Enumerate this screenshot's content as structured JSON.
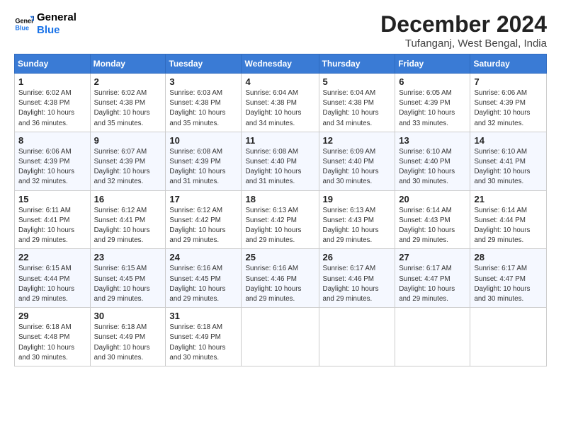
{
  "logo": {
    "line1": "General",
    "line2": "Blue"
  },
  "title": "December 2024",
  "location": "Tufanganj, West Bengal, India",
  "headers": [
    "Sunday",
    "Monday",
    "Tuesday",
    "Wednesday",
    "Thursday",
    "Friday",
    "Saturday"
  ],
  "weeks": [
    [
      {
        "day": "1",
        "info": "Sunrise: 6:02 AM\nSunset: 4:38 PM\nDaylight: 10 hours\nand 36 minutes."
      },
      {
        "day": "2",
        "info": "Sunrise: 6:02 AM\nSunset: 4:38 PM\nDaylight: 10 hours\nand 35 minutes."
      },
      {
        "day": "3",
        "info": "Sunrise: 6:03 AM\nSunset: 4:38 PM\nDaylight: 10 hours\nand 35 minutes."
      },
      {
        "day": "4",
        "info": "Sunrise: 6:04 AM\nSunset: 4:38 PM\nDaylight: 10 hours\nand 34 minutes."
      },
      {
        "day": "5",
        "info": "Sunrise: 6:04 AM\nSunset: 4:38 PM\nDaylight: 10 hours\nand 34 minutes."
      },
      {
        "day": "6",
        "info": "Sunrise: 6:05 AM\nSunset: 4:39 PM\nDaylight: 10 hours\nand 33 minutes."
      },
      {
        "day": "7",
        "info": "Sunrise: 6:06 AM\nSunset: 4:39 PM\nDaylight: 10 hours\nand 32 minutes."
      }
    ],
    [
      {
        "day": "8",
        "info": "Sunrise: 6:06 AM\nSunset: 4:39 PM\nDaylight: 10 hours\nand 32 minutes."
      },
      {
        "day": "9",
        "info": "Sunrise: 6:07 AM\nSunset: 4:39 PM\nDaylight: 10 hours\nand 32 minutes."
      },
      {
        "day": "10",
        "info": "Sunrise: 6:08 AM\nSunset: 4:39 PM\nDaylight: 10 hours\nand 31 minutes."
      },
      {
        "day": "11",
        "info": "Sunrise: 6:08 AM\nSunset: 4:40 PM\nDaylight: 10 hours\nand 31 minutes."
      },
      {
        "day": "12",
        "info": "Sunrise: 6:09 AM\nSunset: 4:40 PM\nDaylight: 10 hours\nand 30 minutes."
      },
      {
        "day": "13",
        "info": "Sunrise: 6:10 AM\nSunset: 4:40 PM\nDaylight: 10 hours\nand 30 minutes."
      },
      {
        "day": "14",
        "info": "Sunrise: 6:10 AM\nSunset: 4:41 PM\nDaylight: 10 hours\nand 30 minutes."
      }
    ],
    [
      {
        "day": "15",
        "info": "Sunrise: 6:11 AM\nSunset: 4:41 PM\nDaylight: 10 hours\nand 29 minutes."
      },
      {
        "day": "16",
        "info": "Sunrise: 6:12 AM\nSunset: 4:41 PM\nDaylight: 10 hours\nand 29 minutes."
      },
      {
        "day": "17",
        "info": "Sunrise: 6:12 AM\nSunset: 4:42 PM\nDaylight: 10 hours\nand 29 minutes."
      },
      {
        "day": "18",
        "info": "Sunrise: 6:13 AM\nSunset: 4:42 PM\nDaylight: 10 hours\nand 29 minutes."
      },
      {
        "day": "19",
        "info": "Sunrise: 6:13 AM\nSunset: 4:43 PM\nDaylight: 10 hours\nand 29 minutes."
      },
      {
        "day": "20",
        "info": "Sunrise: 6:14 AM\nSunset: 4:43 PM\nDaylight: 10 hours\nand 29 minutes."
      },
      {
        "day": "21",
        "info": "Sunrise: 6:14 AM\nSunset: 4:44 PM\nDaylight: 10 hours\nand 29 minutes."
      }
    ],
    [
      {
        "day": "22",
        "info": "Sunrise: 6:15 AM\nSunset: 4:44 PM\nDaylight: 10 hours\nand 29 minutes."
      },
      {
        "day": "23",
        "info": "Sunrise: 6:15 AM\nSunset: 4:45 PM\nDaylight: 10 hours\nand 29 minutes."
      },
      {
        "day": "24",
        "info": "Sunrise: 6:16 AM\nSunset: 4:45 PM\nDaylight: 10 hours\nand 29 minutes."
      },
      {
        "day": "25",
        "info": "Sunrise: 6:16 AM\nSunset: 4:46 PM\nDaylight: 10 hours\nand 29 minutes."
      },
      {
        "day": "26",
        "info": "Sunrise: 6:17 AM\nSunset: 4:46 PM\nDaylight: 10 hours\nand 29 minutes."
      },
      {
        "day": "27",
        "info": "Sunrise: 6:17 AM\nSunset: 4:47 PM\nDaylight: 10 hours\nand 29 minutes."
      },
      {
        "day": "28",
        "info": "Sunrise: 6:17 AM\nSunset: 4:47 PM\nDaylight: 10 hours\nand 30 minutes."
      }
    ],
    [
      {
        "day": "29",
        "info": "Sunrise: 6:18 AM\nSunset: 4:48 PM\nDaylight: 10 hours\nand 30 minutes."
      },
      {
        "day": "30",
        "info": "Sunrise: 6:18 AM\nSunset: 4:49 PM\nDaylight: 10 hours\nand 30 minutes."
      },
      {
        "day": "31",
        "info": "Sunrise: 6:18 AM\nSunset: 4:49 PM\nDaylight: 10 hours\nand 30 minutes."
      },
      {
        "day": "",
        "info": ""
      },
      {
        "day": "",
        "info": ""
      },
      {
        "day": "",
        "info": ""
      },
      {
        "day": "",
        "info": ""
      }
    ]
  ]
}
